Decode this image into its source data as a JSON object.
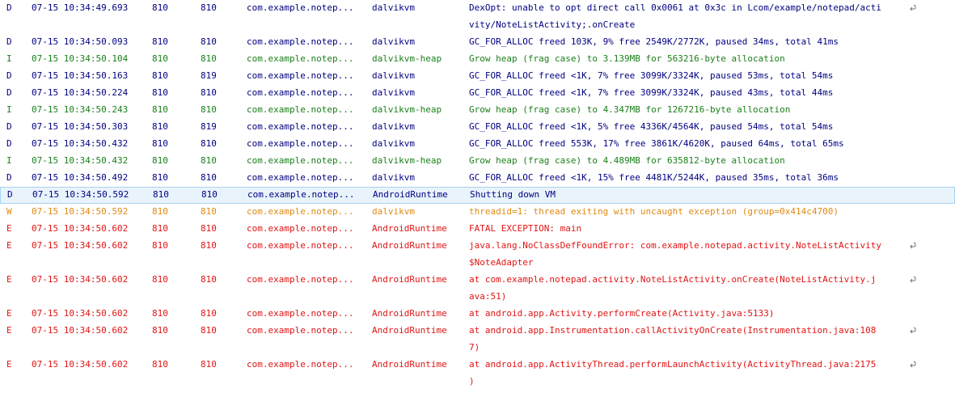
{
  "logcat": {
    "rows": [
      {
        "level": "D",
        "time": "07-15 10:34:49.693",
        "pid": "810",
        "tid": "810",
        "app": "com.example.notep...",
        "tag": "dalvikvm",
        "text": [
          "DexOpt: unable to opt direct call 0x0061 at 0x3c in Lcom/example/notepad/acti",
          "vity/NoteListActivity;.onCreate"
        ],
        "wrapped": true
      },
      {
        "level": "D",
        "time": "07-15 10:34:50.093",
        "pid": "810",
        "tid": "810",
        "app": "com.example.notep...",
        "tag": "dalvikvm",
        "text": [
          "GC_FOR_ALLOC freed 103K, 9% free 2549K/2772K, paused 34ms, total 41ms"
        ],
        "wrapped": false
      },
      {
        "level": "I",
        "time": "07-15 10:34:50.104",
        "pid": "810",
        "tid": "810",
        "app": "com.example.notep...",
        "tag": "dalvikvm-heap",
        "text": [
          "Grow heap (frag case) to 3.139MB for 563216-byte allocation"
        ],
        "wrapped": false
      },
      {
        "level": "D",
        "time": "07-15 10:34:50.163",
        "pid": "810",
        "tid": "819",
        "app": "com.example.notep...",
        "tag": "dalvikvm",
        "text": [
          "GC_FOR_ALLOC freed <1K, 7% free 3099K/3324K, paused 53ms, total 54ms"
        ],
        "wrapped": false
      },
      {
        "level": "D",
        "time": "07-15 10:34:50.224",
        "pid": "810",
        "tid": "810",
        "app": "com.example.notep...",
        "tag": "dalvikvm",
        "text": [
          "GC_FOR_ALLOC freed <1K, 7% free 3099K/3324K, paused 43ms, total 44ms"
        ],
        "wrapped": false
      },
      {
        "level": "I",
        "time": "07-15 10:34:50.243",
        "pid": "810",
        "tid": "810",
        "app": "com.example.notep...",
        "tag": "dalvikvm-heap",
        "text": [
          "Grow heap (frag case) to 4.347MB for 1267216-byte allocation"
        ],
        "wrapped": false
      },
      {
        "level": "D",
        "time": "07-15 10:34:50.303",
        "pid": "810",
        "tid": "819",
        "app": "com.example.notep...",
        "tag": "dalvikvm",
        "text": [
          "GC_FOR_ALLOC freed <1K, 5% free 4336K/4564K, paused 54ms, total 54ms"
        ],
        "wrapped": false
      },
      {
        "level": "D",
        "time": "07-15 10:34:50.432",
        "pid": "810",
        "tid": "810",
        "app": "com.example.notep...",
        "tag": "dalvikvm",
        "text": [
          "GC_FOR_ALLOC freed 553K, 17% free 3861K/4620K, paused 64ms, total 65ms"
        ],
        "wrapped": false
      },
      {
        "level": "I",
        "time": "07-15 10:34:50.432",
        "pid": "810",
        "tid": "810",
        "app": "com.example.notep...",
        "tag": "dalvikvm-heap",
        "text": [
          "Grow heap (frag case) to 4.489MB for 635812-byte allocation"
        ],
        "wrapped": false
      },
      {
        "level": "D",
        "time": "07-15 10:34:50.492",
        "pid": "810",
        "tid": "810",
        "app": "com.example.notep...",
        "tag": "dalvikvm",
        "text": [
          "GC_FOR_ALLOC freed <1K, 15% free 4481K/5244K, paused 35ms, total 36ms"
        ],
        "wrapped": false
      },
      {
        "level": "D",
        "time": "07-15 10:34:50.592",
        "pid": "810",
        "tid": "810",
        "app": "com.example.notep...",
        "tag": "AndroidRuntime",
        "text": [
          "Shutting down VM"
        ],
        "wrapped": false,
        "selected": true
      },
      {
        "level": "W",
        "time": "07-15 10:34:50.592",
        "pid": "810",
        "tid": "810",
        "app": "com.example.notep...",
        "tag": "dalvikvm",
        "text": [
          "threadid=1: thread exiting with uncaught exception (group=0x414c4700)"
        ],
        "wrapped": false
      },
      {
        "level": "E",
        "time": "07-15 10:34:50.602",
        "pid": "810",
        "tid": "810",
        "app": "com.example.notep...",
        "tag": "AndroidRuntime",
        "text": [
          "FATAL EXCEPTION: main"
        ],
        "wrapped": false
      },
      {
        "level": "E",
        "time": "07-15 10:34:50.602",
        "pid": "810",
        "tid": "810",
        "app": "com.example.notep...",
        "tag": "AndroidRuntime",
        "text": [
          "java.lang.NoClassDefFoundError: com.example.notepad.activity.NoteListActivity",
          "$NoteAdapter"
        ],
        "wrapped": true
      },
      {
        "level": "E",
        "time": "07-15 10:34:50.602",
        "pid": "810",
        "tid": "810",
        "app": "com.example.notep...",
        "tag": "AndroidRuntime",
        "text": [
          "at com.example.notepad.activity.NoteListActivity.onCreate(NoteListActivity.j",
          "ava:51)"
        ],
        "wrapped": true
      },
      {
        "level": "E",
        "time": "07-15 10:34:50.602",
        "pid": "810",
        "tid": "810",
        "app": "com.example.notep...",
        "tag": "AndroidRuntime",
        "text": [
          "at android.app.Activity.performCreate(Activity.java:5133)"
        ],
        "wrapped": false
      },
      {
        "level": "E",
        "time": "07-15 10:34:50.602",
        "pid": "810",
        "tid": "810",
        "app": "com.example.notep...",
        "tag": "AndroidRuntime",
        "text": [
          "at android.app.Instrumentation.callActivityOnCreate(Instrumentation.java:108",
          "7)"
        ],
        "wrapped": true
      },
      {
        "level": "E",
        "time": "07-15 10:34:50.602",
        "pid": "810",
        "tid": "810",
        "app": "com.example.notep...",
        "tag": "AndroidRuntime",
        "text": [
          "at android.app.ActivityThread.performLaunchActivity(ActivityThread.java:2175",
          ")"
        ],
        "wrapped": true
      }
    ]
  },
  "colors": {
    "D": "#000080",
    "I": "#1a7f1a",
    "W": "#e08a14",
    "E": "#e01515",
    "selected_bg": "#e8f3fb",
    "selected_border": "#a8d4f0"
  },
  "icons": {
    "wrap": "wrap-icon"
  }
}
